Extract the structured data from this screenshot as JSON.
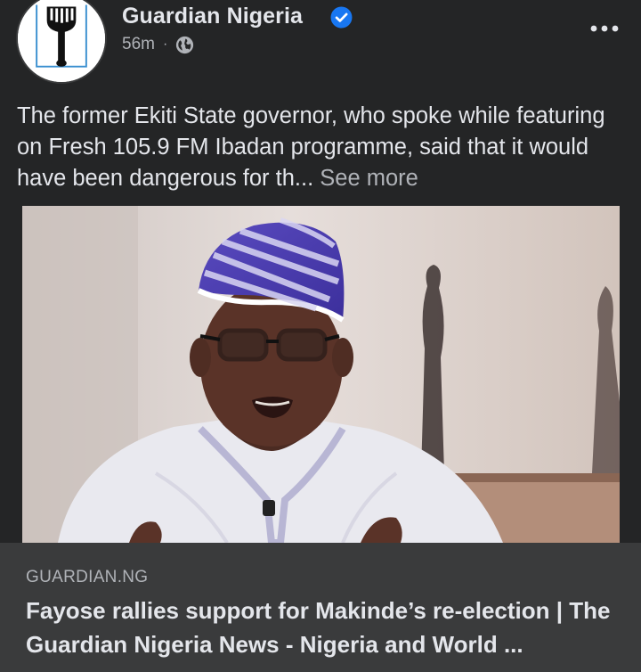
{
  "post": {
    "page_name": "Guardian Nigeria",
    "time": "56m",
    "separator": "·",
    "privacy_icon": "globe-icon",
    "verified_icon": "verified-badge-icon",
    "more_icon": "more-options-icon",
    "caption": "The former Ekiti State governor, who spoke while featuring on Fresh 105.9 FM Ibadan programme, said that it would have been dangerous for th...",
    "see_more": "See more"
  },
  "link": {
    "domain": "GUARDIAN.NG",
    "title": "Fayose rallies support for Makinde’s re-election | The Guardian Nigeria News - Nigeria and World ..."
  },
  "colors": {
    "background": "#242526",
    "card": "#3a3b3c",
    "text_primary": "#e4e6eb",
    "text_secondary": "#b0b3b8",
    "verified_blue": "#1877f2"
  }
}
